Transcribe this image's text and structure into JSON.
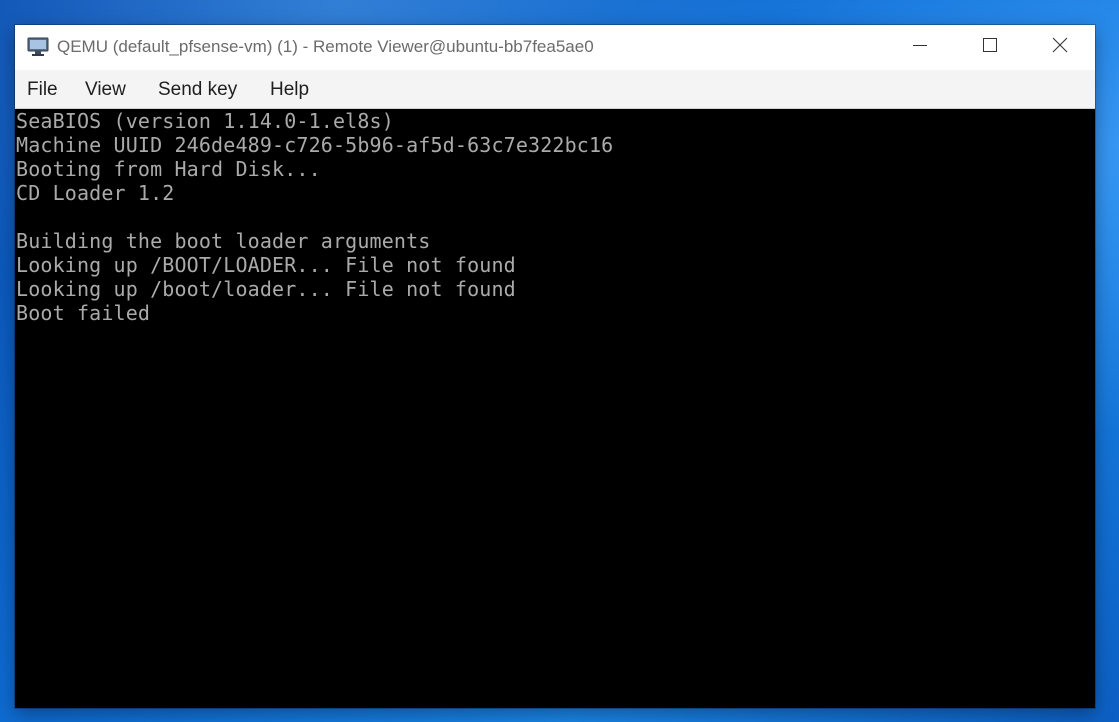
{
  "window": {
    "title": "QEMU (default_pfsense-vm) (1) - Remote Viewer@ubuntu-bb7fea5ae0",
    "icons": {
      "app": "monitor-icon",
      "minimize": "minimize-icon",
      "maximize": "maximize-icon",
      "close": "close-icon"
    }
  },
  "menu": {
    "file": "File",
    "view": "View",
    "send_key": "Send key",
    "help": "Help"
  },
  "console": {
    "lines": [
      "SeaBIOS (version 1.14.0-1.el8s)",
      "Machine UUID 246de489-c726-5b96-af5d-63c7e322bc16",
      "Booting from Hard Disk...",
      "CD Loader 1.2",
      "",
      "Building the boot loader arguments",
      "Looking up /BOOT/LOADER... File not found",
      "Looking up /boot/loader... File not found",
      "Boot failed"
    ]
  },
  "colors": {
    "desktop_accent": "#0f6fd6",
    "console_background": "#000000",
    "console_text": "#aaaaaa",
    "title_text": "#6b6b6b"
  }
}
